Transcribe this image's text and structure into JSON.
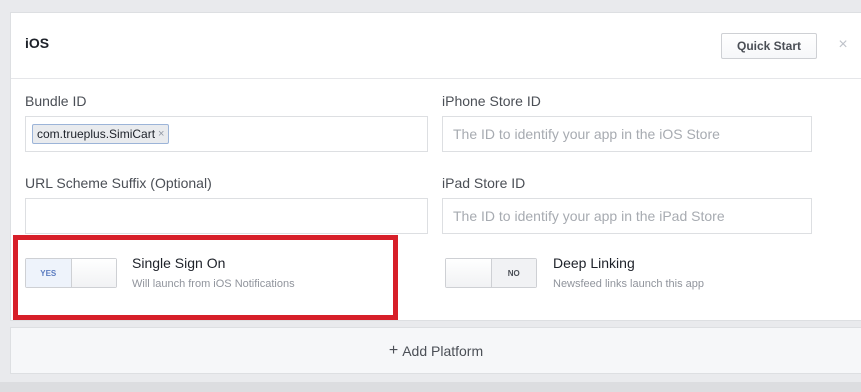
{
  "platform": {
    "title": "iOS",
    "quick_start_label": "Quick Start",
    "close_glyph": "×"
  },
  "fields": {
    "bundle_id": {
      "label": "Bundle ID",
      "token": "com.trueplus.SimiCart",
      "token_remove": "×"
    },
    "iphone_store_id": {
      "label": "iPhone Store ID",
      "placeholder": "The ID to identify your app in the iOS Store",
      "value": ""
    },
    "url_scheme_suffix": {
      "label": "URL Scheme Suffix (Optional)",
      "value": ""
    },
    "ipad_store_id": {
      "label": "iPad Store ID",
      "placeholder": "The ID to identify your app in the iPad Store",
      "value": ""
    }
  },
  "options": {
    "single_sign_on": {
      "toggle_label": "YES",
      "title": "Single Sign On",
      "description": "Will launch from iOS Notifications",
      "state": "on"
    },
    "deep_linking": {
      "toggle_label": "NO",
      "title": "Deep Linking",
      "description": "Newsfeed links launch this app",
      "state": "off"
    }
  },
  "add_platform": {
    "plus": "+",
    "label": "Add Platform"
  },
  "colors": {
    "highlight": "#d71f29",
    "accent": "#5b7cc0"
  }
}
